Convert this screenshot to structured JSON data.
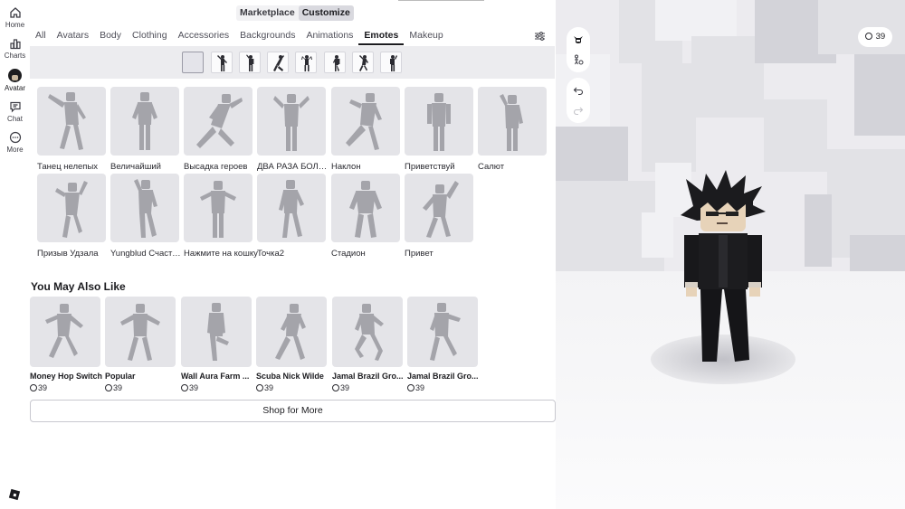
{
  "nav": {
    "items": [
      {
        "label": "Home",
        "icon": "home-icon"
      },
      {
        "label": "Charts",
        "icon": "charts-icon"
      },
      {
        "label": "Avatar",
        "icon": "avatar-icon"
      },
      {
        "label": "Chat",
        "icon": "chat-icon"
      },
      {
        "label": "More",
        "icon": "more-icon"
      }
    ],
    "logo": "roblox-logo"
  },
  "top_switch": {
    "marketplace": "Marketplace",
    "customize": "Customize",
    "active": "Customize"
  },
  "tabs": [
    "All",
    "Avatars",
    "Body",
    "Clothing",
    "Accessories",
    "Backgrounds",
    "Animations",
    "Emotes",
    "Makeup"
  ],
  "active_tab": "Emotes",
  "emotes": [
    {
      "name": "Танец нелепых"
    },
    {
      "name": "Величайший"
    },
    {
      "name": "Высадка героев"
    },
    {
      "name": "ДВА РАЗА БОЛЬШЕ"
    },
    {
      "name": "Наклон"
    },
    {
      "name": "Приветствуй"
    },
    {
      "name": "Салют"
    },
    {
      "name": "Призыв Удзала"
    },
    {
      "name": "Yungblud Счастливый"
    },
    {
      "name": "Нажмите на кошку"
    },
    {
      "name": "Точка2"
    },
    {
      "name": "Стадион"
    },
    {
      "name": "Привет"
    }
  ],
  "recommendations": {
    "title": "You May Also Like",
    "items": [
      {
        "name": "Money Hop Switch",
        "price": "39"
      },
      {
        "name": "Popular",
        "price": "39"
      },
      {
        "name": "Wall Aura Farm ...",
        "price": "39"
      },
      {
        "name": "Scuba Nick Wilde",
        "price": "39"
      },
      {
        "name": "Jamal Brazil Gro...",
        "price": "39"
      },
      {
        "name": "Jamal Brazil Gro...",
        "price": "39"
      }
    ],
    "shop_label": "Shop for More"
  },
  "viewport": {
    "robux_balance": "39",
    "tools": [
      "avatar-head-icon",
      "pose-icon",
      "undo-icon",
      "redo-icon"
    ]
  },
  "colors": {
    "accent": "#1b1b1f",
    "tile": "#e4e4e8",
    "strip": "#ececef"
  }
}
